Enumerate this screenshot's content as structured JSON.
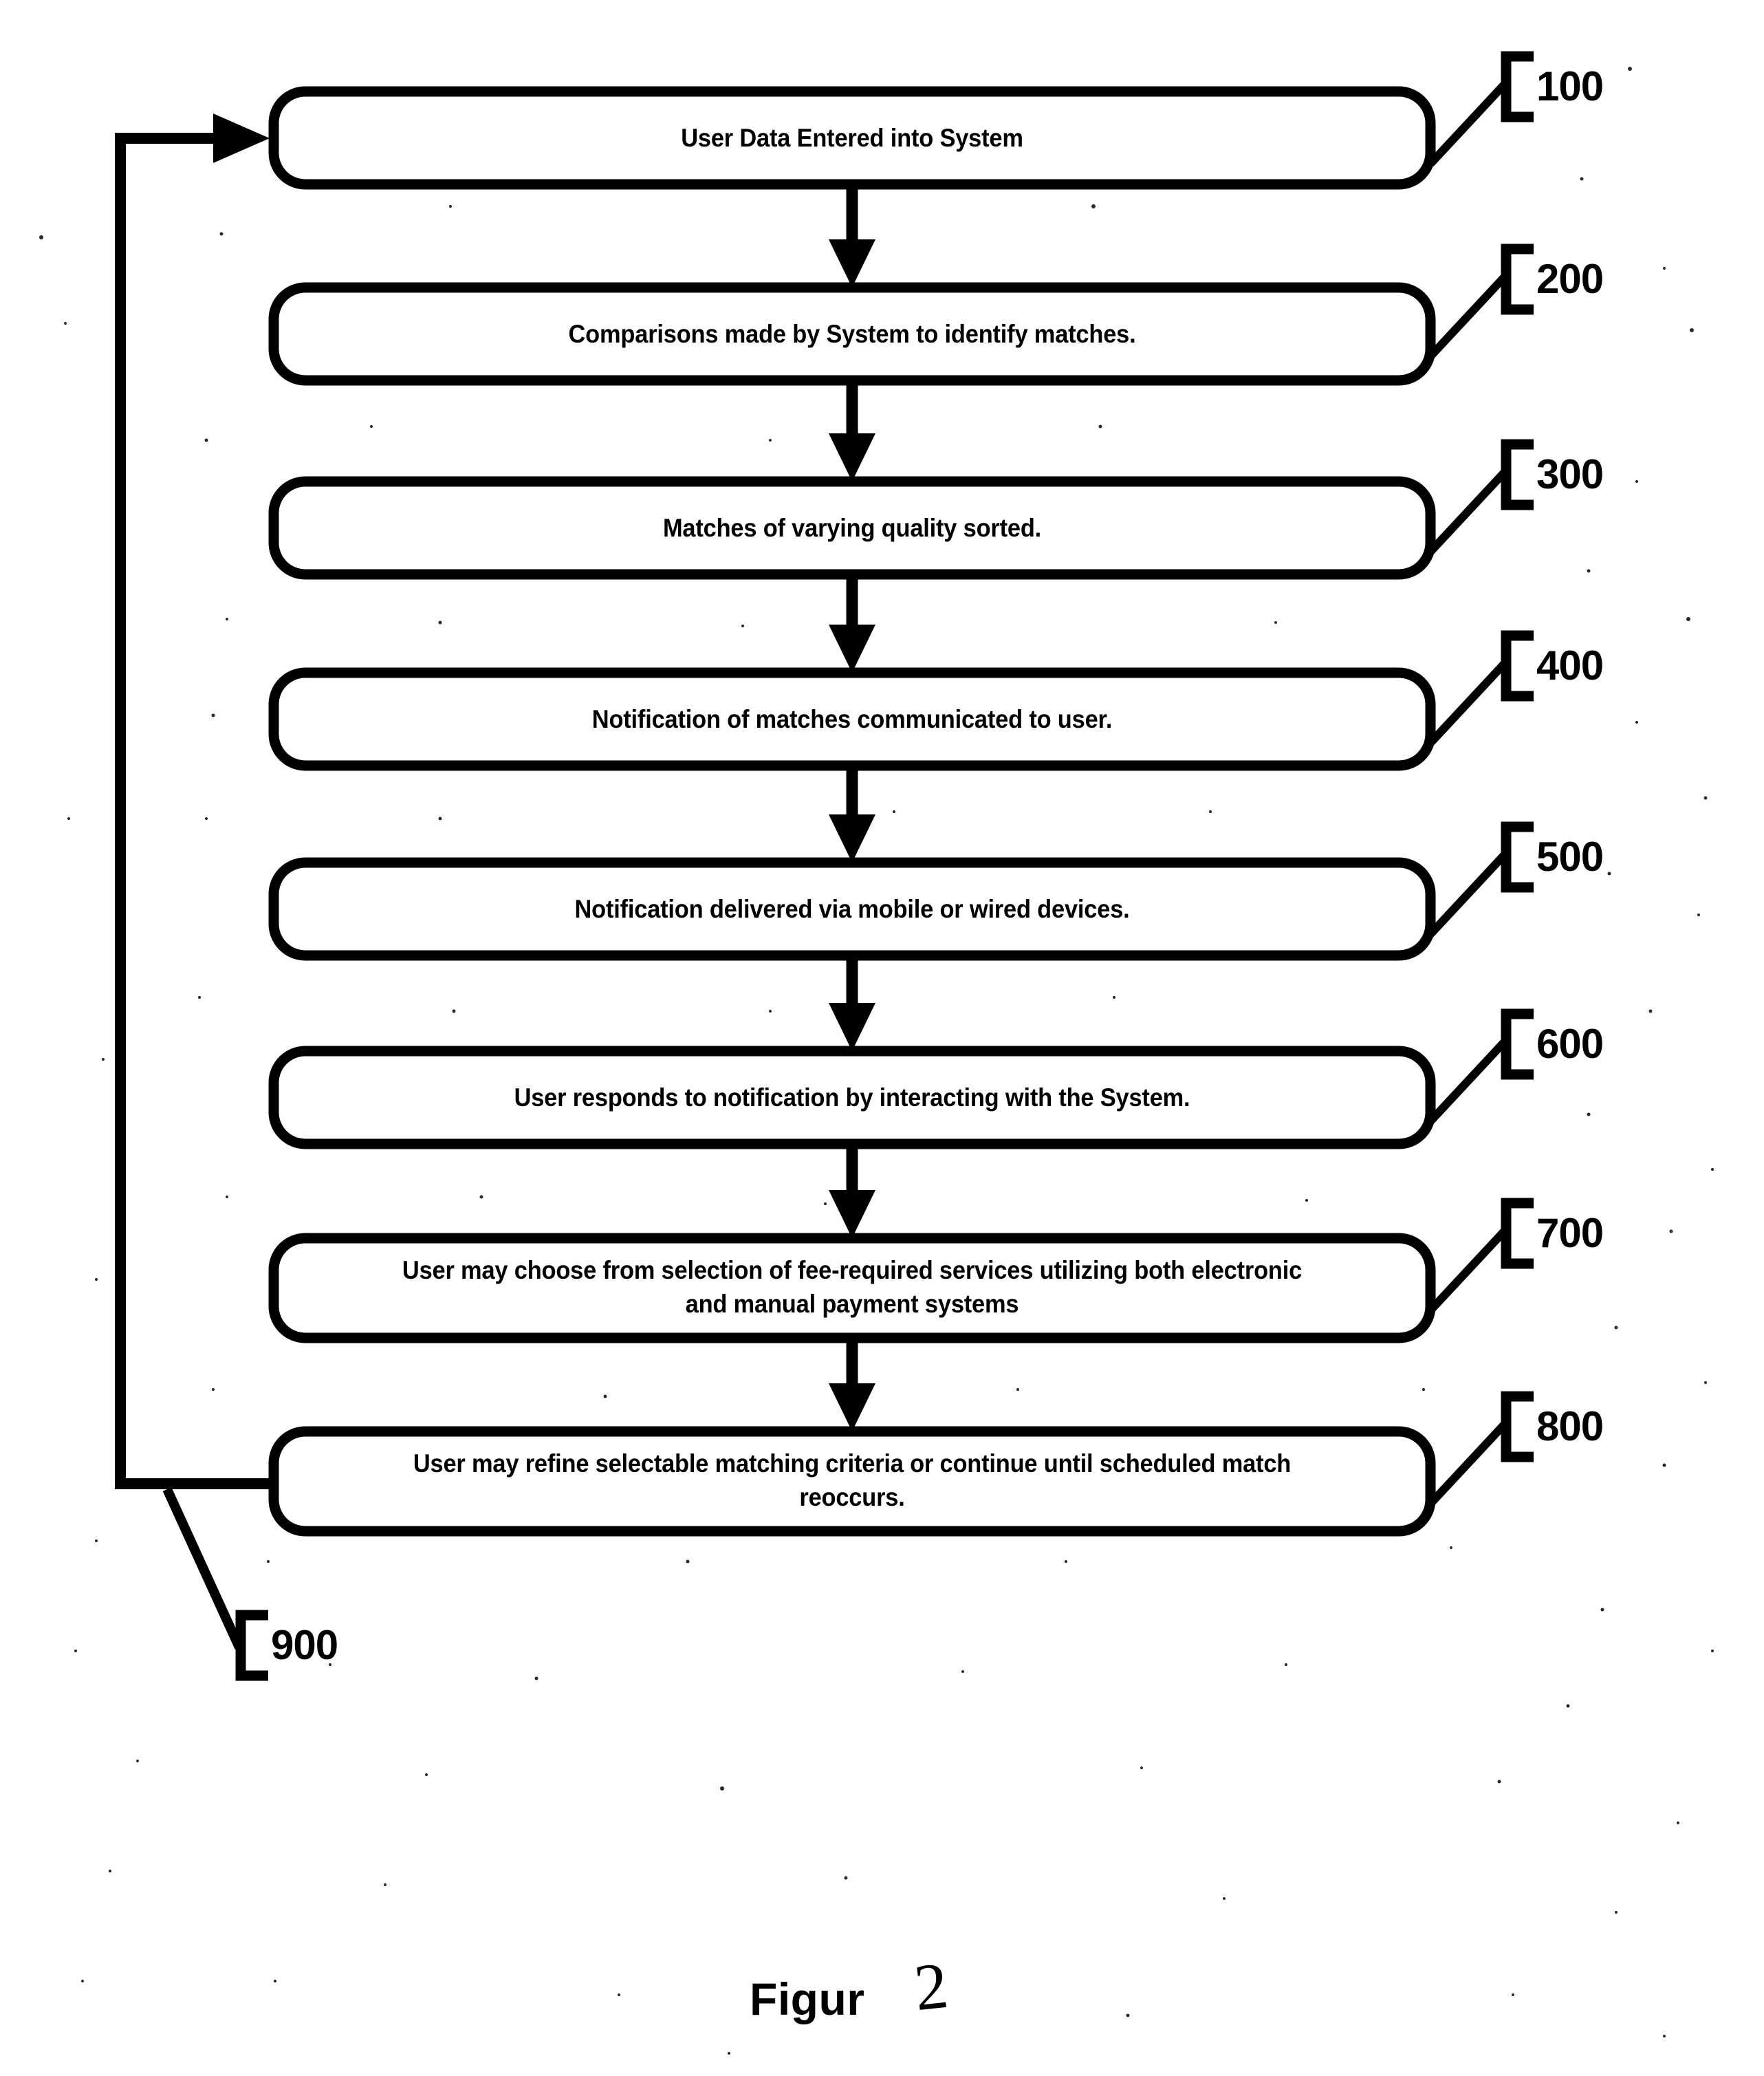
{
  "figure": {
    "caption_label": "Figur",
    "caption_number": "2"
  },
  "flowchart": {
    "type": "flowchart",
    "orientation": "top-to-bottom",
    "shape": "rounded-rectangle",
    "line_color": "#000000",
    "fill_color": "#ffffff",
    "steps": [
      {
        "ref": "100",
        "lines": [
          "User Data Entered into System"
        ],
        "text": "User Data Entered into System"
      },
      {
        "ref": "200",
        "lines": [
          "Comparisons made by System to identify matches."
        ],
        "text": "Comparisons made by System to identify matches."
      },
      {
        "ref": "300",
        "lines": [
          "Matches of varying quality sorted."
        ],
        "text": "Matches of varying quality sorted."
      },
      {
        "ref": "400",
        "lines": [
          "Notification of matches communicated to user."
        ],
        "text": "Notification of matches communicated to user."
      },
      {
        "ref": "500",
        "lines": [
          "Notification delivered via mobile or wired devices."
        ],
        "text": "Notification delivered via mobile or wired devices."
      },
      {
        "ref": "600",
        "lines": [
          "User responds to notification by interacting with the System."
        ],
        "text": "User responds to notification by interacting with the System."
      },
      {
        "ref": "700",
        "lines": [
          "User may choose from selection of fee-required services utilizing both electronic",
          "and manual payment systems"
        ],
        "text": "User may choose from selection of fee-required services utilizing both electronic and manual payment systems"
      },
      {
        "ref": "800",
        "lines": [
          "User may refine selectable matching criteria or continue until scheduled match",
          "reoccurs."
        ],
        "text": "User may refine selectable matching criteria or continue until scheduled match reoccurs."
      }
    ],
    "feedback_loop": {
      "ref": "900",
      "from_step_ref": "800",
      "to_step_ref": "100",
      "description": "feedback loop from step 800 back to step 100"
    }
  }
}
